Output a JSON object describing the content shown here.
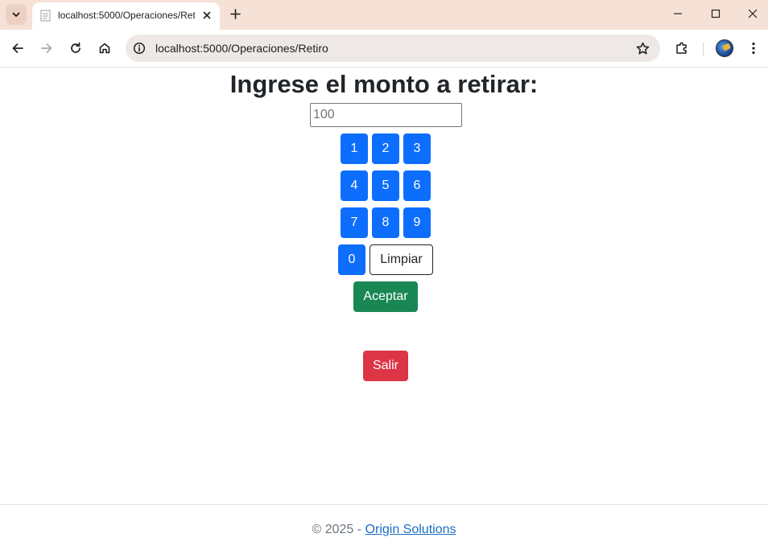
{
  "browser": {
    "tab_title": "localhost:5000/Operaciones/Retiro",
    "url": "localhost:5000/Operaciones/Retiro"
  },
  "page": {
    "heading": "Ingrese el monto a retirar:",
    "amount_input": {
      "value": "",
      "placeholder": "100"
    },
    "keypad": {
      "keys": [
        "1",
        "2",
        "3",
        "4",
        "5",
        "6",
        "7",
        "8",
        "9",
        "0"
      ],
      "clear_label": "Limpiar"
    },
    "accept_label": "Aceptar",
    "exit_label": "Salir"
  },
  "footer": {
    "copyright": "© 2025 - ",
    "link_text": "Origin Solutions"
  },
  "colors": {
    "primary": "#0d6efd",
    "success": "#198754",
    "danger": "#dc3545",
    "tabbar": "#f6e1d6"
  }
}
